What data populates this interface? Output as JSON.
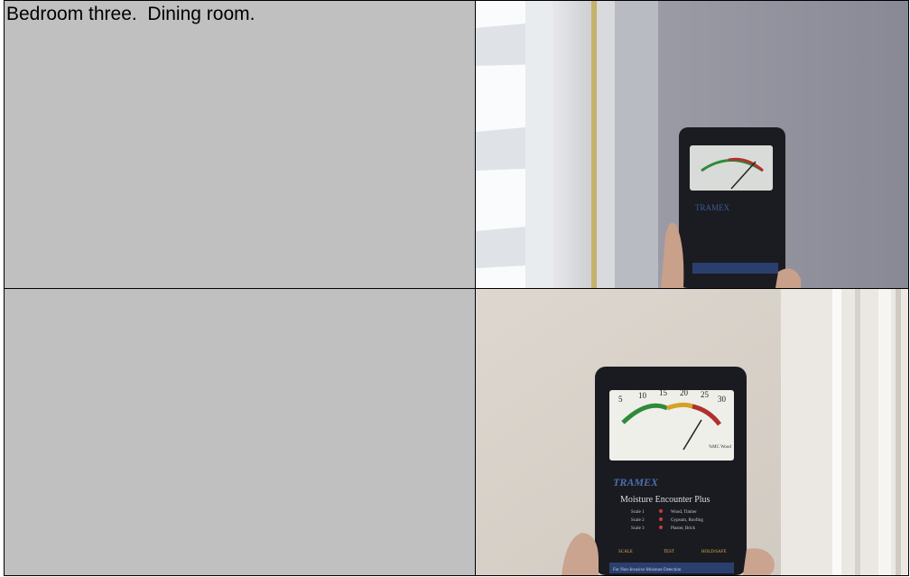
{
  "rows": [
    {
      "caption": "Bedroom three.  Dining room.",
      "photo": {
        "subject": "moisture-meter-near-window",
        "meter_brand": "TRAMEX",
        "wall_color": "#8e8f9a",
        "shutter_color": "#f4f6f8"
      }
    },
    {
      "caption": "",
      "photo": {
        "subject": "moisture-meter-on-wall",
        "meter_brand": "TRAMEX",
        "meter_model": "Moisture Encounter Plus",
        "scale_labels": [
          "5",
          "10",
          "15",
          "20",
          "25",
          "30"
        ],
        "scale_box_label": "%MC Wood",
        "settings": [
          {
            "label": "Scale 1",
            "value": "Wood, Timber"
          },
          {
            "label": "Scale 2",
            "value": "Gypsum, Roofing"
          },
          {
            "label": "Scale 3",
            "value": "Plaster, Brick"
          }
        ],
        "buttons": [
          "SCALE",
          "TEST",
          "HOLD/SAFE"
        ],
        "footer": "For Non-Invasive Moisture Detection",
        "wall_color": "#d8d2ca"
      }
    }
  ]
}
